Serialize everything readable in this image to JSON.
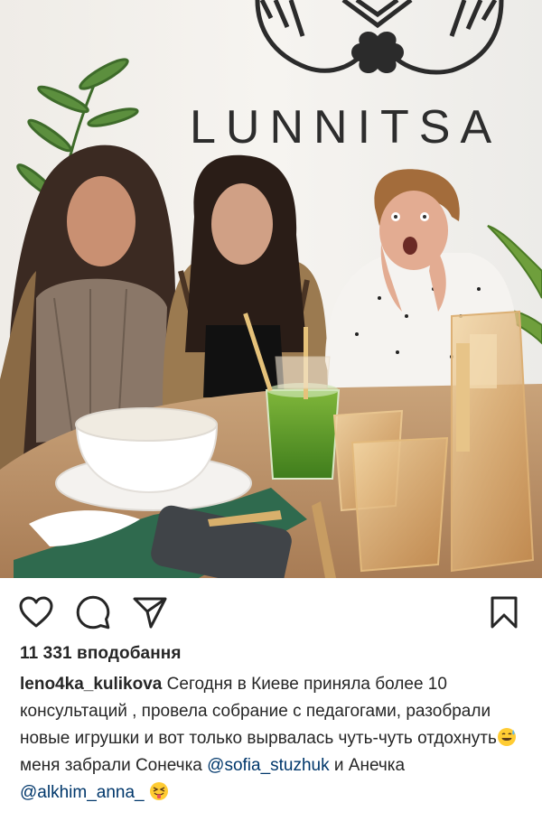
{
  "post": {
    "photo": {
      "sign_text": "LUNNITSA"
    },
    "actions": {
      "like": "heart-icon",
      "comment": "comment-icon",
      "share": "paper-plane-icon",
      "save": "bookmark-icon"
    },
    "likes_text": "11 331 вподобання",
    "caption": {
      "author": "leno4ka_kulikova",
      "text_1": " Сегодня в Киеве приняла более 10 консультаций , провела собрание с педагогами, разобрали новые игрушки и вот только вырвалась чуть-чуть отдохнуть",
      "text_2": " меня забрали Сонечка ",
      "mention_1": "@sofia_stuzhuk",
      "text_3": " и Анечка ",
      "mention_2": "@alkhim_anna_",
      "text_4": " "
    },
    "colors": {
      "text": "#262626",
      "mention": "#00376b",
      "background": "#ffffff"
    }
  }
}
